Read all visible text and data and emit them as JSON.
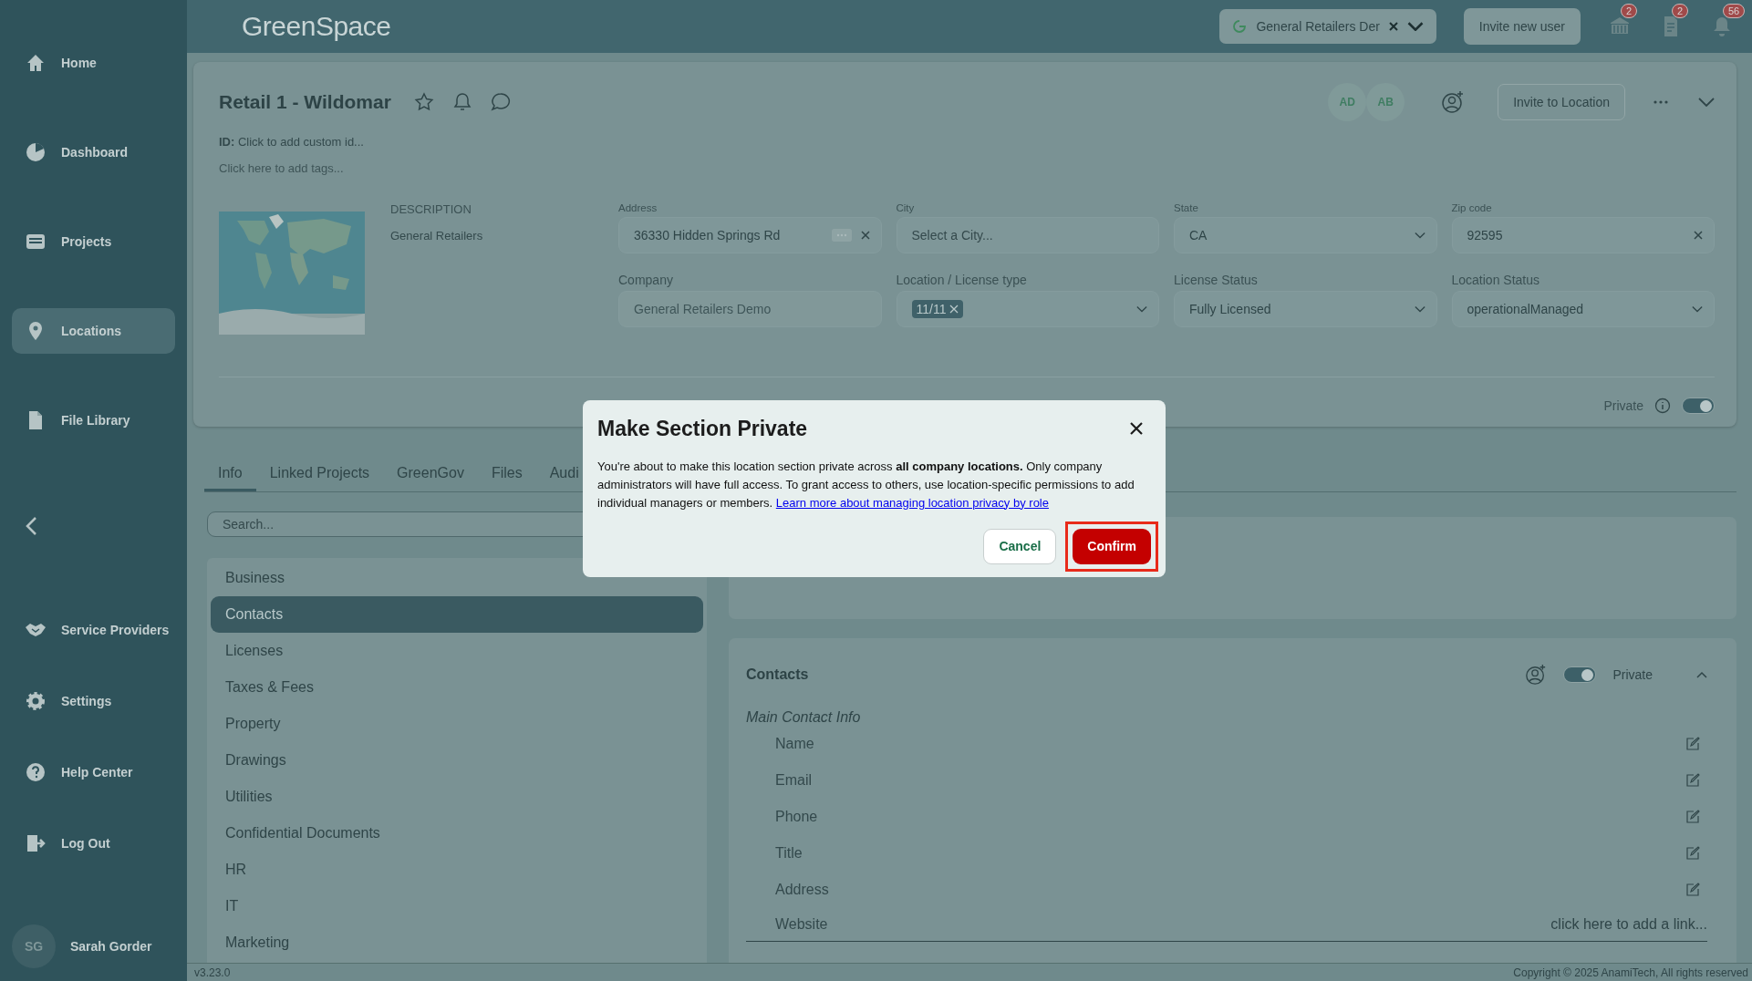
{
  "app": {
    "logo": "GreenSpace"
  },
  "sidebar": {
    "items": [
      {
        "label": "Home",
        "selected": false
      },
      {
        "label": "Dashboard",
        "selected": false
      },
      {
        "label": "Projects",
        "selected": false
      },
      {
        "label": "Locations",
        "selected": true
      },
      {
        "label": "File Library",
        "selected": false
      }
    ],
    "bottom_items": [
      {
        "label": "Service Providers",
        "selected": false
      },
      {
        "label": "Settings",
        "selected": false
      },
      {
        "label": "Help Center",
        "selected": false
      },
      {
        "label": "Log Out",
        "selected": false
      }
    ],
    "user": {
      "initials": "SG",
      "name": "Sarah Gorder"
    }
  },
  "topbar": {
    "company_selector": "General Retailers Der",
    "invite_button": "Invite new user",
    "badges": [
      {
        "count": "2"
      },
      {
        "count": "2"
      },
      {
        "count": "56"
      }
    ]
  },
  "location": {
    "title": "Retail 1 - Wildomar",
    "id_label": "ID:",
    "id_placeholder": "Click to add custom id...",
    "tags_placeholder": "Click here to add tags...",
    "members": [
      "AD",
      "AB"
    ],
    "invite_button": "Invite to Location",
    "description_label": "DESCRIPTION",
    "description": "General Retailers",
    "fields": [
      {
        "label": "Address",
        "value": "36330 Hidden Springs Rd",
        "kind": "address"
      },
      {
        "label": "City",
        "placeholder": "Select a City...",
        "kind": "text"
      },
      {
        "label": "State",
        "value": "CA",
        "kind": "select"
      },
      {
        "label": "Zip code",
        "value": "92595",
        "kind": "clearable"
      },
      {
        "label": "Company",
        "value": "General Retailers Demo",
        "kind": "readonly"
      },
      {
        "label": "Location / License type",
        "chip": "11/11",
        "kind": "chips"
      },
      {
        "label": "License Status",
        "value": "Fully Licensed",
        "kind": "select"
      },
      {
        "label": "Location Status",
        "value": "operationalManaged",
        "kind": "select"
      }
    ],
    "private_label": "Private",
    "private": true
  },
  "tabs": [
    {
      "label": "Info",
      "selected": true
    },
    {
      "label": "Linked Projects",
      "selected": false
    },
    {
      "label": "GreenGov",
      "selected": false
    },
    {
      "label": "Files",
      "selected": false
    },
    {
      "label": "Audi",
      "selected": false
    }
  ],
  "search": {
    "placeholder": "Search..."
  },
  "sections": [
    {
      "label": "Business",
      "selected": false
    },
    {
      "label": "Contacts",
      "selected": true
    },
    {
      "label": "Licenses",
      "selected": false
    },
    {
      "label": "Taxes & Fees",
      "selected": false
    },
    {
      "label": "Property",
      "selected": false
    },
    {
      "label": "Drawings",
      "selected": false
    },
    {
      "label": "Utilities",
      "selected": false
    },
    {
      "label": "Confidential Documents",
      "selected": false
    },
    {
      "label": "HR",
      "selected": false
    },
    {
      "label": "IT",
      "selected": false
    },
    {
      "label": "Marketing",
      "selected": false
    }
  ],
  "contacts": {
    "title": "Contacts",
    "private": true,
    "private_label": "Private",
    "subtitle": "Main Contact Info",
    "rows": [
      {
        "label": "Name",
        "kind": "edit"
      },
      {
        "label": "Email",
        "kind": "edit"
      },
      {
        "label": "Phone",
        "kind": "edit"
      },
      {
        "label": "Title",
        "kind": "edit"
      },
      {
        "label": "Address",
        "kind": "edit"
      },
      {
        "label": "Website",
        "kind": "link",
        "placeholder": "click here to add a link..."
      }
    ]
  },
  "footer": {
    "version": "v3.23.0",
    "copyright": "Copyright © 2025 AnamiTech, All rights reserved"
  },
  "modal": {
    "title": "Make Section Private",
    "body": "You're about to make this location section private across **all company locations.** Only company administrators will have full access. To grant access to others, use location-specific permissions to add individual managers or members.",
    "link": "Learn more about managing location privacy by role",
    "buttons": [
      {
        "label": "Cancel",
        "kind": "secondary",
        "highlighted": false
      },
      {
        "label": "Confirm",
        "kind": "primary",
        "highlighted": true
      }
    ]
  }
}
